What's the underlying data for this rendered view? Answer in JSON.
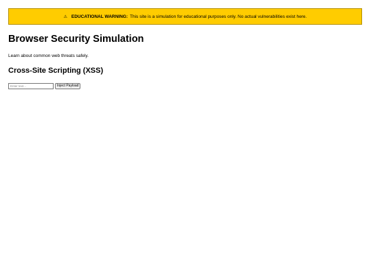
{
  "banner": {
    "icon": "⚠",
    "icon_name": "warning-icon",
    "strong_label": "EDUCATIONAL WARNING:",
    "message": "This site is a simulation for educational purposes only. No actual vulnerabilities exist here.",
    "background_color": "#ffcc00"
  },
  "page": {
    "title": "Browser Security Simulation",
    "intro": "Learn about common web threats safely."
  },
  "xss_section": {
    "title": "Cross-Site Scripting (XSS)",
    "input_placeholder": "Enter text...",
    "input_value": "",
    "button_label": "Inject Payload"
  }
}
